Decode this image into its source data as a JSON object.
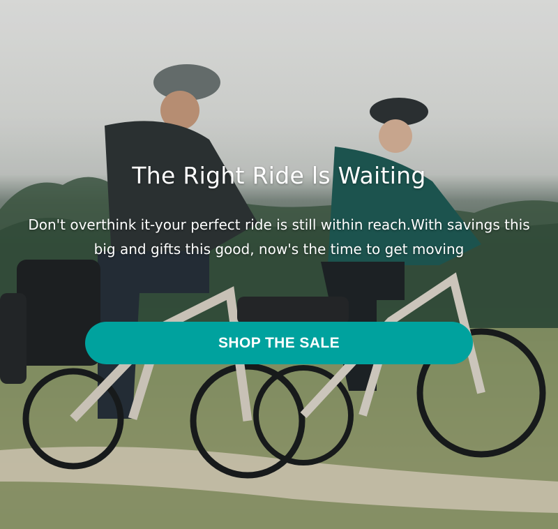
{
  "hero": {
    "image_description_icon": "couple-riding-ebikes-photo",
    "headline": "The Right Ride ls Waiting",
    "subtext": "Don't overthink it-your perfect ride is still within reach.With savings this big and gifts this good, now's the time to get moving",
    "cta_label": "SHOP THE SALE",
    "colors": {
      "cta_background": "#00a29e",
      "text": "#ffffff"
    }
  }
}
